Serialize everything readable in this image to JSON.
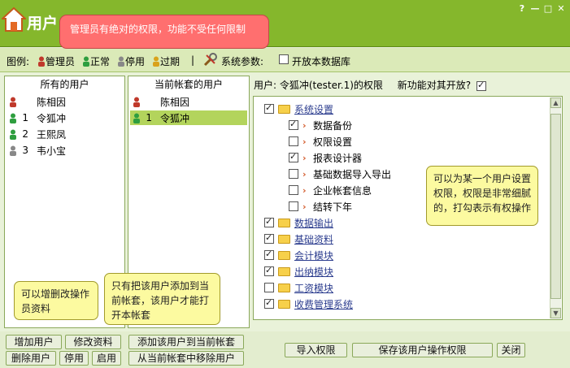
{
  "window": {
    "title": "用户",
    "btn_help": "?",
    "btn_min": "—",
    "btn_max": "□",
    "btn_close": "✕"
  },
  "tooltips": {
    "admin": "管理员有绝对的权限，功能不受任何限制",
    "perm": "可以为某一个用户设置权限，权限是非常细腻的，打勾表示有权操作",
    "add_edit": "可以增删改操作员资料",
    "add_account": "只有把该用户添加到当前帐套，该用户才能打开本帐套"
  },
  "legend": {
    "label": "图例:",
    "admin": "管理员",
    "normal": "正常",
    "disabled": "停用",
    "expired": "过期",
    "sep": "|",
    "sys_params": "系统参数:",
    "open_db": "开放本数据库"
  },
  "all_users": {
    "header": "所有的用户",
    "rows": [
      {
        "num": "",
        "name": "陈相因",
        "color": "#c0392b"
      },
      {
        "num": "1",
        "name": "令狐冲",
        "color": "#2e9e3f"
      },
      {
        "num": "2",
        "name": "王熙凤",
        "color": "#2e9e3f"
      },
      {
        "num": "3",
        "name": "韦小宝",
        "color": "#888888"
      }
    ]
  },
  "account_users": {
    "header": "当前帐套的用户",
    "rows": [
      {
        "num": "",
        "name": "陈相因",
        "color": "#c0392b"
      },
      {
        "num": "1",
        "name": "令狐冲",
        "color": "#2e9e3f"
      }
    ]
  },
  "permissions": {
    "header_user": "用户: 令狐冲(tester.1)的权限",
    "header_new": "新功能对其开放?",
    "tree": [
      {
        "label": "系统设置",
        "checked": true,
        "level": 0
      },
      {
        "label": "数据备份",
        "checked": true,
        "level": 1
      },
      {
        "label": "权限设置",
        "checked": false,
        "level": 1
      },
      {
        "label": "报表设计器",
        "checked": true,
        "level": 1
      },
      {
        "label": "基础数据导入导出",
        "checked": false,
        "level": 1
      },
      {
        "label": "企业帐套信息",
        "checked": false,
        "level": 1
      },
      {
        "label": "结转下年",
        "checked": false,
        "level": 1
      },
      {
        "label": "数据输出",
        "checked": true,
        "level": 0
      },
      {
        "label": "基础资料",
        "checked": true,
        "level": 0
      },
      {
        "label": "会计模块",
        "checked": true,
        "level": 0
      },
      {
        "label": "出纳模块",
        "checked": true,
        "level": 0
      },
      {
        "label": "工资模块",
        "checked": false,
        "level": 0
      },
      {
        "label": "收费管理系统",
        "checked": true,
        "level": 0
      }
    ]
  },
  "buttons": {
    "add_user": "增加用户",
    "edit_info": "修改资料",
    "delete_user": "删除用户",
    "disable": "停用",
    "enable": "启用",
    "add_to_account": "添加该用户到当前帐套",
    "remove_from_account": "从当前帐套中移除用户",
    "import_perm": "导入权限",
    "save_perm": "保存该用户操作权限",
    "close": "关闭"
  },
  "colors": {
    "title_bg": "#85b72c",
    "admin": "#c0392b",
    "normal": "#2e9e3f",
    "disabled": "#888888",
    "expired": "#d9a21b"
  }
}
